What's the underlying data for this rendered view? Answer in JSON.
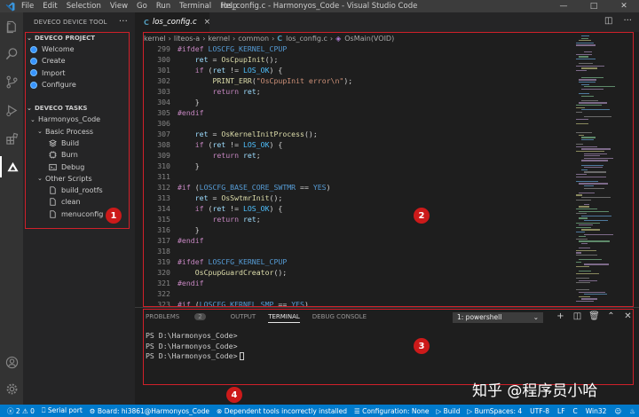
{
  "window": {
    "title": "los_config.c - Harmonyos_Code - Visual Studio Code",
    "menu": [
      "File",
      "Edit",
      "Selection",
      "View",
      "Go",
      "Run",
      "Terminal",
      "Help"
    ],
    "controls": [
      "—",
      "□",
      "✕"
    ]
  },
  "sidebar": {
    "title": "DEVECO DEVICE TOOL",
    "more": "···",
    "project_section": "DEVECO PROJECT",
    "project_items": [
      "Welcome",
      "Create",
      "Import",
      "Configure"
    ],
    "tasks_section": "DEVECO TASKS",
    "tasks": {
      "root": "Harmonyos_Code",
      "basic": "Basic Process",
      "basic_items": [
        "Build",
        "Burn",
        "Debug"
      ],
      "other": "Other Scripts",
      "other_items": [
        "build_rootfs",
        "clean",
        "menuconfig"
      ]
    }
  },
  "editor": {
    "tab_label": "los_config.c",
    "tab_close": "×",
    "breadcrumb": [
      "kernel",
      "liteos-a",
      "kernel",
      "common",
      "los_config.c",
      "OsMain(VOID)"
    ],
    "line_numbers": [
      "299",
      "300",
      "301",
      "302",
      "303",
      "304",
      "305",
      "306",
      "307",
      "308",
      "309",
      "310",
      "311",
      "312",
      "313",
      "314",
      "315",
      "316",
      "317",
      "318",
      "319",
      "320",
      "321",
      "322",
      "323"
    ]
  },
  "panel": {
    "tabs": [
      "PROBLEMS",
      "OUTPUT",
      "TERMINAL",
      "DEBUG CONSOLE"
    ],
    "problems_count": "2",
    "terminal_select": "1: powershell",
    "terminal_lines": [
      "PS D:\\Harmonyos_Code>",
      "PS D:\\Harmonyos_Code>",
      "PS D:\\Harmonyos_Code>"
    ]
  },
  "statusbar": {
    "problems": "ⓧ 2 ⚠ 0",
    "serial": "Serial port",
    "board": "Board: hi3861@Harmonyos_Code",
    "dependent": "Dependent tools incorrectly installed",
    "configuration": "Configuration: None",
    "build": "Build",
    "burn": "Burn",
    "right": [
      "Spaces: 4",
      "UTF-8",
      "LF",
      "C",
      "Win32"
    ]
  },
  "annotations": [
    "1",
    "2",
    "3",
    "4"
  ],
  "watermark": "知乎 @程序员小哈",
  "colors": {
    "accent": "#007acc",
    "annotation": "#d0202a"
  }
}
